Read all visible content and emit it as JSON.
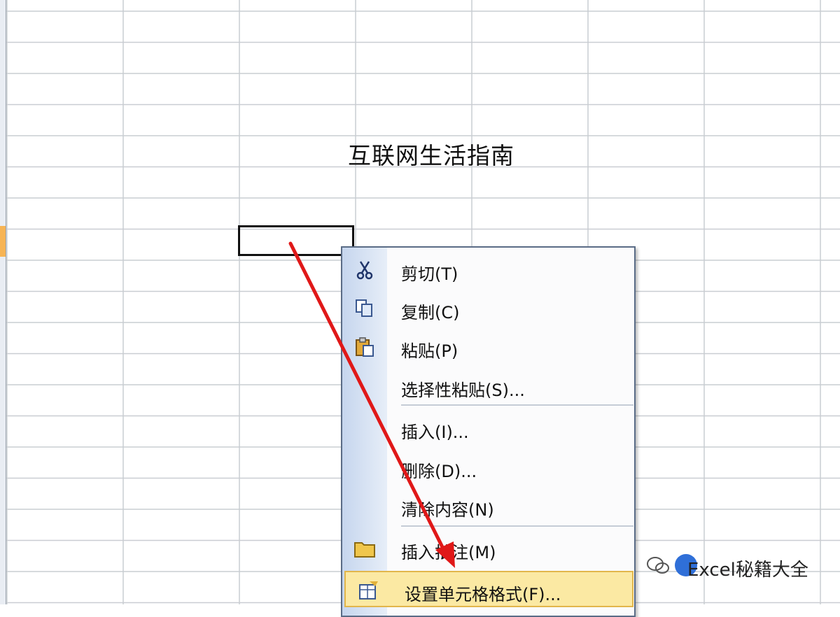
{
  "sheet": {
    "cell_text": "互联网生活指南"
  },
  "context_menu": {
    "items": [
      {
        "label": "剪切(T)",
        "icon": "scissors-icon"
      },
      {
        "label": "复制(C)",
        "icon": "copy-icon"
      },
      {
        "label": "粘贴(P)",
        "icon": "paste-icon"
      },
      {
        "label": "选择性粘贴(S)...",
        "icon": ""
      },
      {
        "label": "插入(I)...",
        "icon": ""
      },
      {
        "label": "删除(D)...",
        "icon": ""
      },
      {
        "label": "清除内容(N)",
        "icon": ""
      },
      {
        "label": "插入批注(M)",
        "icon": "folder-comment-icon"
      },
      {
        "label": "设置单元格格式(F)...",
        "icon": "format-cells-icon"
      }
    ],
    "highlighted_label": "设置单元格格式(F)..."
  },
  "watermark": {
    "text": "Excel秘籍大全"
  },
  "colors": {
    "arrow": "#e01818",
    "highlight": "#fbe9a3",
    "active_row_header": "#f7b454"
  }
}
